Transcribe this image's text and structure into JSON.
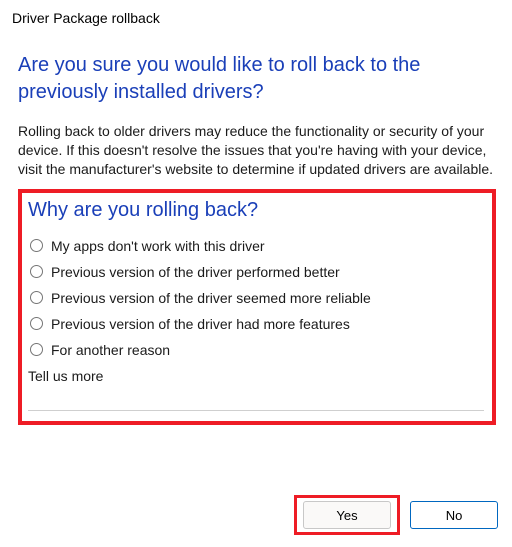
{
  "window_title": "Driver Package rollback",
  "heading": "Are you sure you would like to roll back to the previously installed drivers?",
  "body_text": "Rolling back to older drivers may reduce the functionality or security of your device. If this doesn't resolve the issues that you're having with your device, visit the manufacturer's website to determine if updated drivers are available.",
  "subheading": "Why are you rolling back?",
  "reasons": [
    "My apps don't work with this driver",
    "Previous version of the driver performed better",
    "Previous version of the driver seemed more reliable",
    "Previous version of the driver had more features",
    "For another reason"
  ],
  "tellus_label": "Tell us more",
  "tellus_value": "",
  "buttons": {
    "yes": "Yes",
    "no": "No"
  },
  "highlight_color": "#ee1c25",
  "accent_color": "#0067c0"
}
